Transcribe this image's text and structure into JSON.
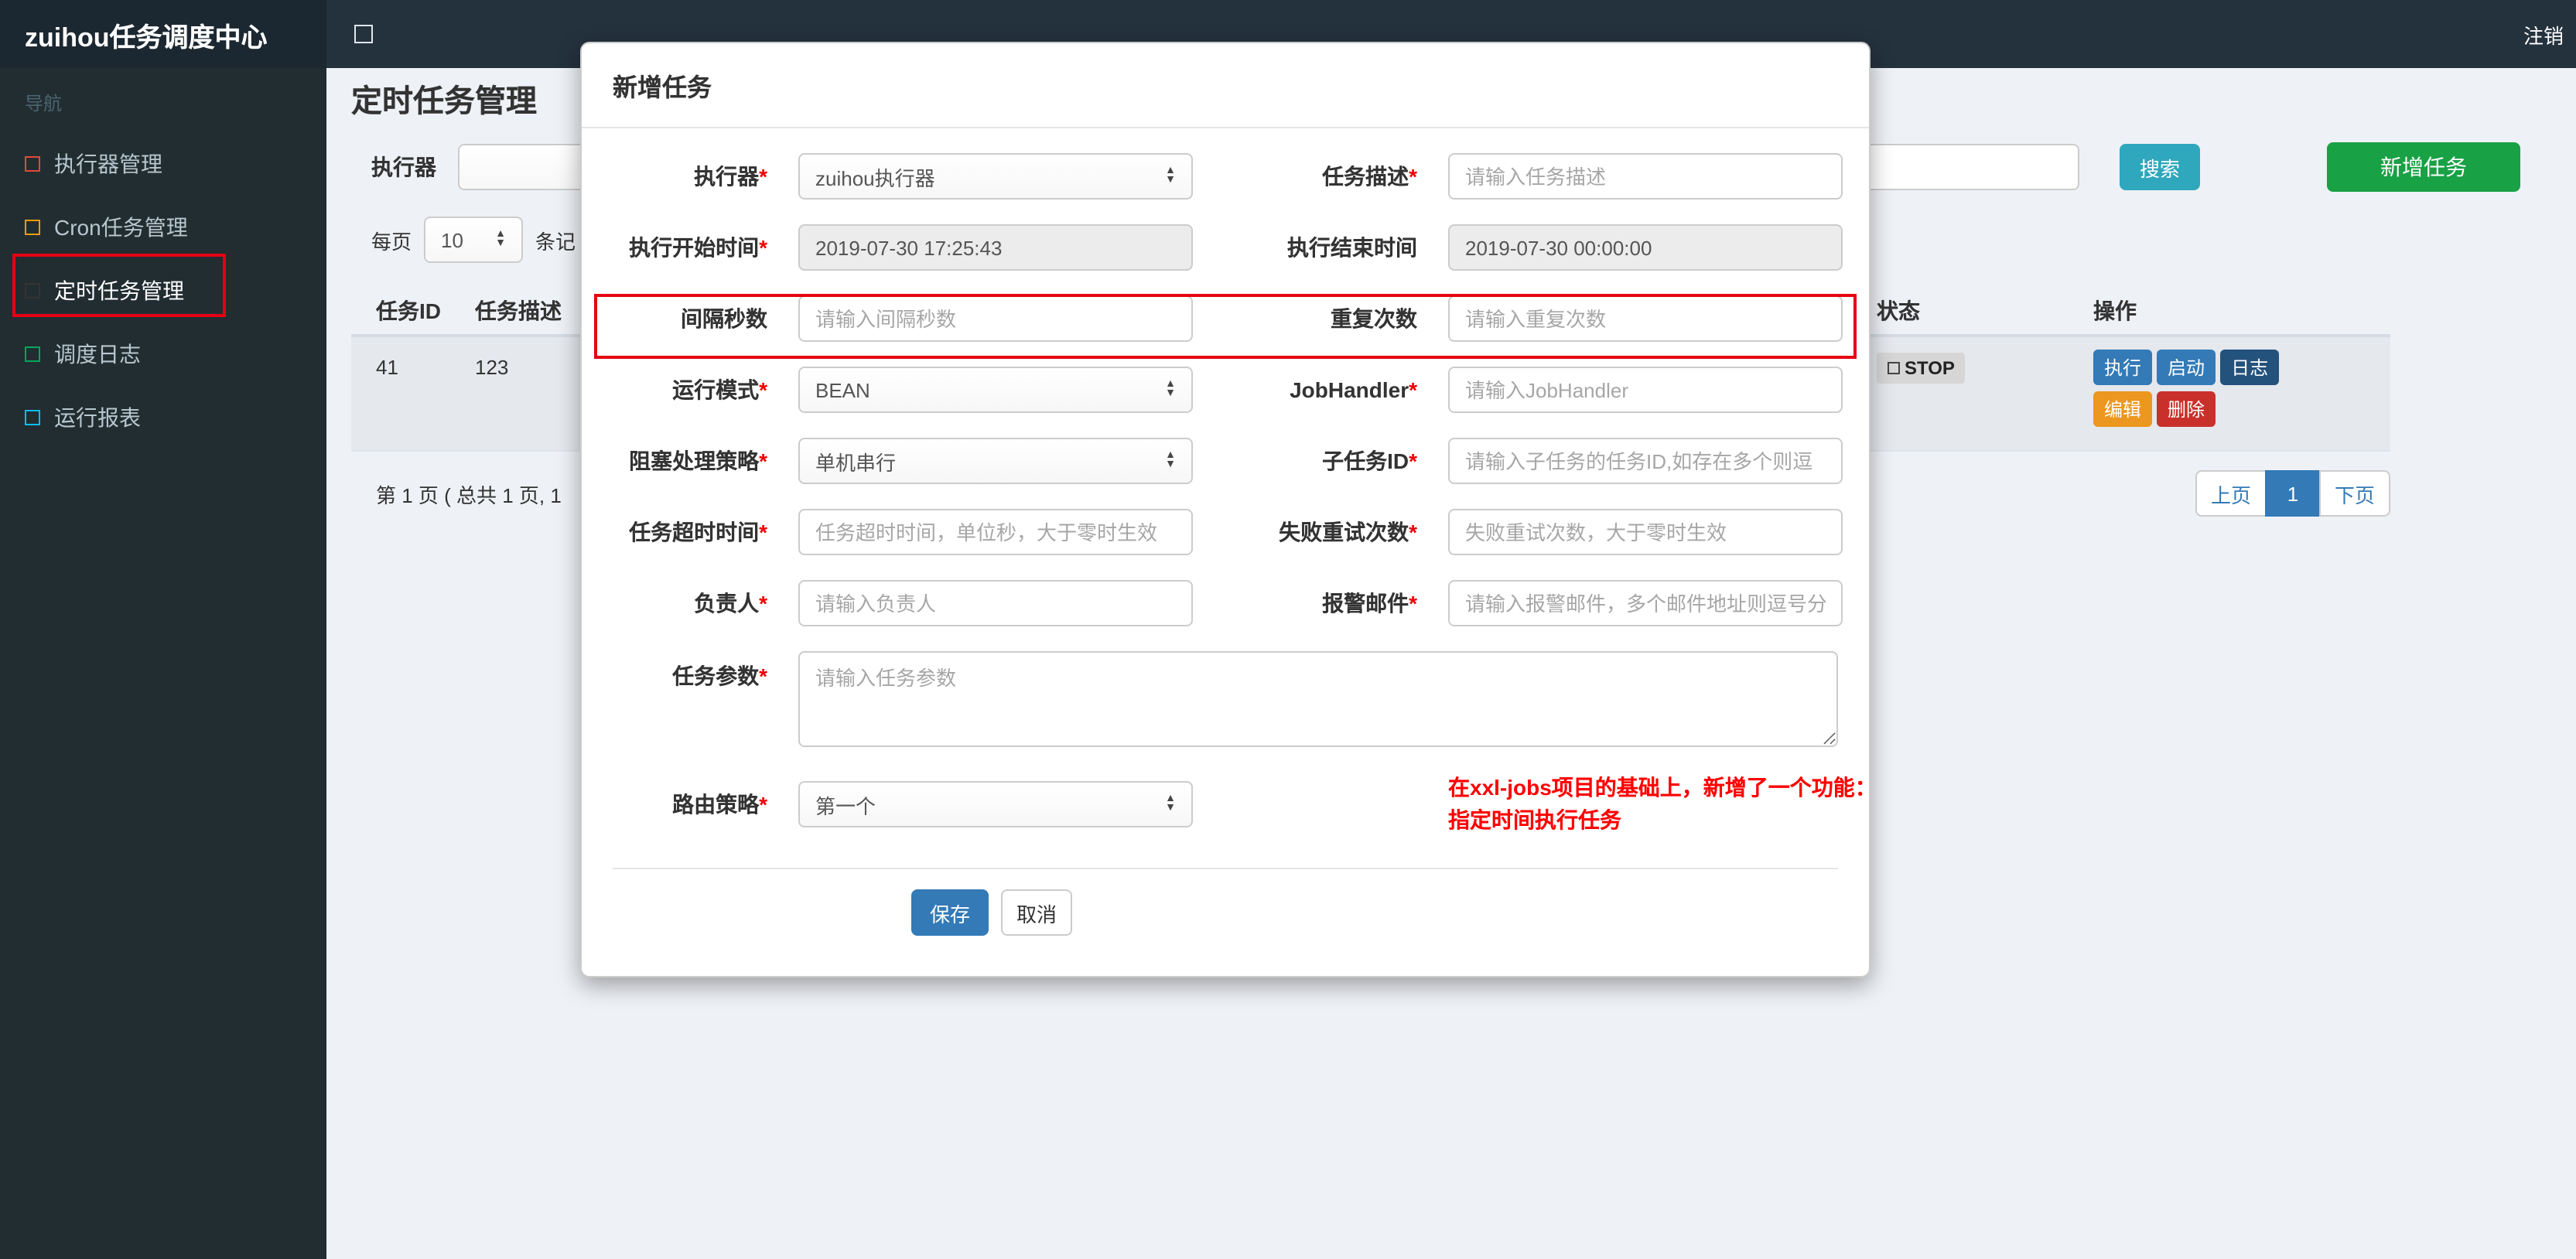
{
  "colors": {
    "header_bg": "#24323e",
    "brand_bg": "#1c2831",
    "sidebar_bg": "#222d32",
    "accent_blue": "#337ab7",
    "search_teal": "#2fa7bd",
    "add_green": "#18a145",
    "edit_orange": "#ec971f",
    "delete_red": "#c9302c",
    "annotation_red": "#e60012",
    "note_red": "#ff0000"
  },
  "header": {
    "brand": "zuihou任务调度中心",
    "toggle_icon": "",
    "logout": "注销"
  },
  "sidebar": {
    "section_label": "导航",
    "items": [
      {
        "label": "执行器管理",
        "icon_color": "#dd4b39",
        "active": false
      },
      {
        "label": "Cron任务管理",
        "icon_color": "#f39c12",
        "active": false
      },
      {
        "label": "定时任务管理",
        "icon_color": "#333333",
        "active": true
      },
      {
        "label": "调度日志",
        "icon_color": "#00a65a",
        "active": false
      },
      {
        "label": "运行报表",
        "icon_color": "#00c0ef",
        "active": false
      }
    ]
  },
  "page": {
    "title": "定时任务管理"
  },
  "filter": {
    "executor_label": "执行器",
    "search_button": "搜索",
    "add_button": "新增任务"
  },
  "per_page": {
    "prefix": "每页",
    "value": "10",
    "suffix": "条记"
  },
  "table": {
    "headers": {
      "id": "任务ID",
      "desc": "任务描述",
      "status": "状态",
      "actions": "操作"
    },
    "row": {
      "id": "41",
      "desc": "123",
      "status": "STOP",
      "actions": {
        "run": "执行",
        "start": "启动",
        "log": "日志",
        "edit": "编辑",
        "del": "删除"
      }
    }
  },
  "pagination": {
    "summary": "第 1 页 ( 总共 1 页, 1",
    "prev": "上页",
    "current": "1",
    "next": "下页"
  },
  "modal": {
    "title": "新增任务",
    "fields": {
      "executor": {
        "label": "执行器",
        "req": "*",
        "value": "zuihou执行器"
      },
      "job_desc": {
        "label": "任务描述",
        "req": "*",
        "placeholder": "请输入任务描述"
      },
      "start_time": {
        "label": "执行开始时间",
        "req": "*",
        "value": "2019-07-30 17:25:43"
      },
      "end_time": {
        "label": "执行结束时间",
        "req": "",
        "value": "2019-07-30 00:00:00"
      },
      "interval": {
        "label": "间隔秒数",
        "req": "",
        "placeholder": "请输入间隔秒数"
      },
      "repeat": {
        "label": "重复次数",
        "req": "",
        "placeholder": "请输入重复次数"
      },
      "glue_type": {
        "label": "运行模式",
        "req": "*",
        "value": "BEAN"
      },
      "job_handler": {
        "label": "JobHandler",
        "req": "*",
        "placeholder": "请输入JobHandler"
      },
      "block_strategy": {
        "label": "阻塞处理策略",
        "req": "*",
        "value": "单机串行"
      },
      "child_job": {
        "label": "子任务ID",
        "req": "*",
        "placeholder": "请输入子任务的任务ID,如存在多个则逗"
      },
      "timeout": {
        "label": "任务超时时间",
        "req": "*",
        "placeholder": "任务超时时间，单位秒，大于零时生效"
      },
      "retry": {
        "label": "失败重试次数",
        "req": "*",
        "placeholder": "失败重试次数，大于零时生效"
      },
      "owner": {
        "label": "负责人",
        "req": "*",
        "placeholder": "请输入负责人"
      },
      "alarm_email": {
        "label": "报警邮件",
        "req": "*",
        "placeholder": "请输入报警邮件，多个邮件地址则逗号分"
      },
      "job_param": {
        "label": "任务参数",
        "req": "*",
        "placeholder": "请输入任务参数"
      },
      "route_strategy": {
        "label": "路由策略",
        "req": "*",
        "value": "第一个"
      }
    },
    "note_line1": "在xxl-jobs项目的基础上，新增了一个功能：",
    "note_line2": "指定时间执行任务",
    "save_button": "保存",
    "cancel_button": "取消"
  }
}
